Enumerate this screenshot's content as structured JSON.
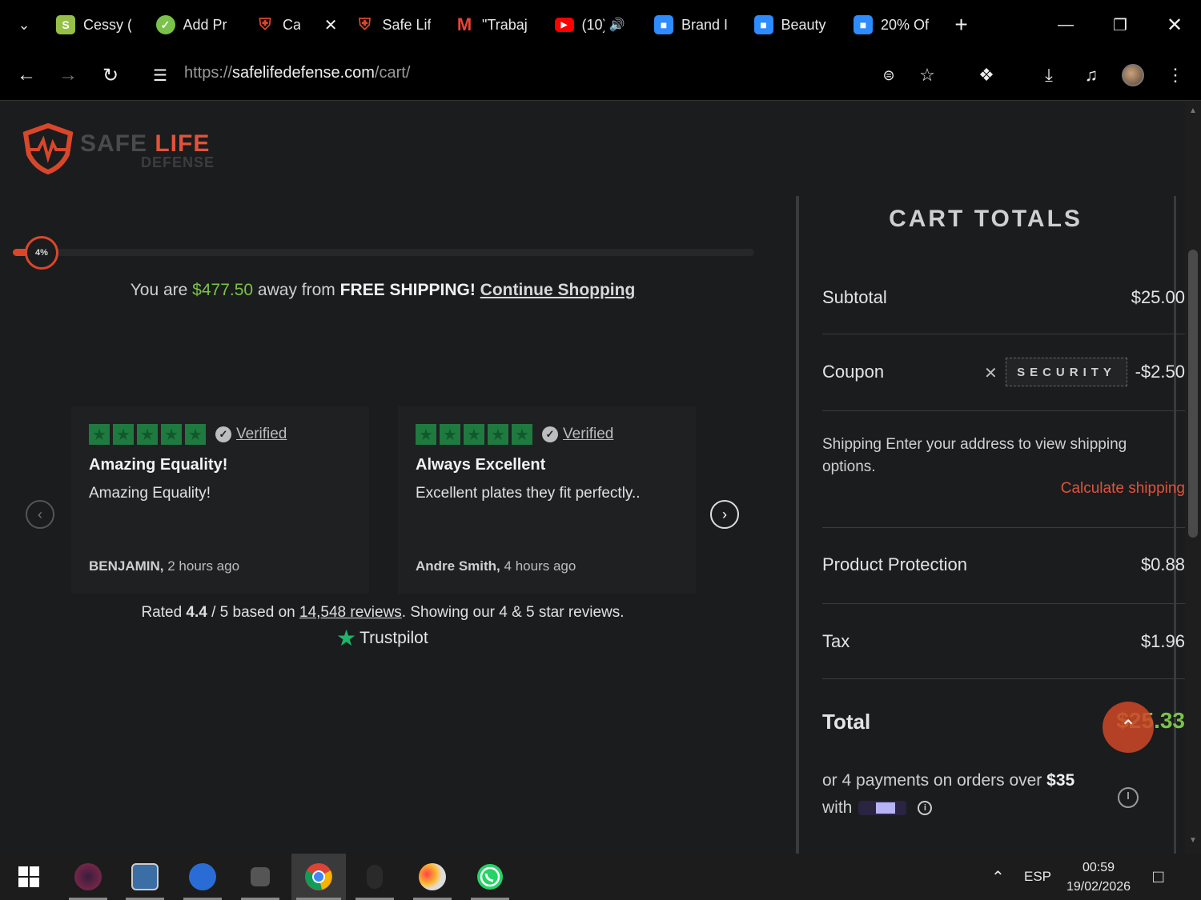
{
  "browser": {
    "tabs": [
      {
        "title": "Cessy (",
        "icon": "shopify-icon",
        "color": "#95bf47"
      },
      {
        "title": "Add Pr",
        "icon": "green-badge-icon",
        "color": "#7ac24a"
      },
      {
        "title": "Ca",
        "icon": "shield-logo-icon",
        "color": "#d9472b",
        "active": true
      },
      {
        "title": "Safe Lif",
        "icon": "shield-logo-icon",
        "color": "#d9472b"
      },
      {
        "title": "\"Trabaj",
        "icon": "gmail-icon",
        "color": "#ea4335"
      },
      {
        "title": "(10)",
        "icon": "youtube-icon",
        "color": "#ff0000"
      },
      {
        "title": "Brand I",
        "icon": "chat-bubble-icon",
        "color": "#2d8cff"
      },
      {
        "title": "Beauty",
        "icon": "chat-bubble-icon",
        "color": "#2d8cff"
      },
      {
        "title": "20% Of",
        "icon": "chat-bubble-icon",
        "color": "#2d8cff"
      }
    ],
    "url_scheme": "https://",
    "url_host": "safelifedefense.com",
    "url_path": "/cart/"
  },
  "logo": {
    "word_safe": "SAFE",
    "word_life": "LIFE",
    "word_defense": "DEFENSE"
  },
  "shipping_progress": {
    "percent_label": "4%",
    "percent": 4,
    "msg_prefix": "You are",
    "amount": "$477.50",
    "msg_mid": "away from",
    "msg_bold": "FREE SHIPPING!",
    "link": "Continue Shopping"
  },
  "reviews": [
    {
      "verified": "Verified",
      "title": "Amazing Equality!",
      "body": "Amazing Equality!",
      "author": "BENJAMIN,",
      "time": "2 hours ago",
      "stars": 5
    },
    {
      "verified": "Verified",
      "title": "Always Excellent",
      "body": "Excellent plates they fit perfectly..",
      "author": "Andre Smith,",
      "time": "4 hours ago",
      "stars": 5
    }
  ],
  "rating": {
    "prefix": "Rated",
    "score": "4.4",
    "out_of": "/ 5 based on",
    "count_link": "14,548 reviews",
    "suffix": ". Showing our 4 & 5 star reviews.",
    "brand": "Trustpilot"
  },
  "cart": {
    "title": "CART TOTALS",
    "subtotal_label": "Subtotal",
    "subtotal_value": "$25.00",
    "coupon_label": "Coupon",
    "coupon_code": "SECURITY",
    "coupon_value": "-$2.50",
    "shipping_text": "Shipping Enter your address to view shipping options.",
    "calc_shipping": "Calculate shipping",
    "protection_label": "Product Protection",
    "protection_value": "$0.88",
    "tax_label": "Tax",
    "tax_value": "$1.96",
    "total_label": "Total",
    "total_value": "$25.33",
    "pay_prefix": "or 4 payments on orders over",
    "pay_amount": "$35",
    "pay_with": "with"
  },
  "taskbar": {
    "lang": "ESP",
    "time": "00:59",
    "date": "19/02/2026"
  }
}
